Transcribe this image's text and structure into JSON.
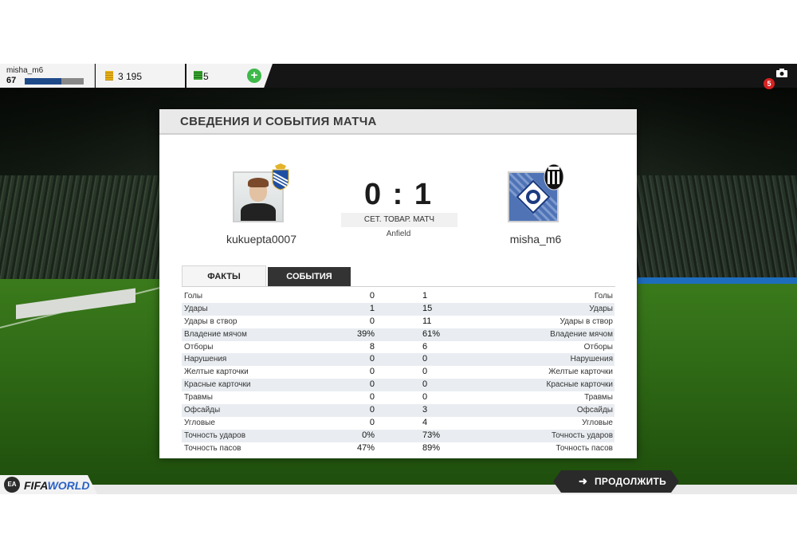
{
  "topbar": {
    "username": "misha_m6",
    "level": "67",
    "xp_fraction": 0.62,
    "coins": "3 195",
    "points": "5",
    "add_label": "+",
    "notification_count": "5"
  },
  "panel": {
    "title": "СВЕДЕНИЯ И СОБЫТИЯ МАТЧА",
    "home_player": "kukuepta0007",
    "away_player": "misha_m6",
    "score": "0 : 1",
    "match_type": "СЕТ. ТОВАР. МАТЧ",
    "venue": "Anfield",
    "tabs": [
      "ФАКТЫ",
      "СОБЫТИЯ"
    ],
    "stats": [
      {
        "label": "Голы",
        "home": "0",
        "away": "1"
      },
      {
        "label": "Удары",
        "home": "1",
        "away": "15"
      },
      {
        "label": "Удары в створ",
        "home": "0",
        "away": "11"
      },
      {
        "label": "Владение мячом",
        "home": "39%",
        "away": "61%"
      },
      {
        "label": "Отборы",
        "home": "8",
        "away": "6"
      },
      {
        "label": "Нарушения",
        "home": "0",
        "away": "0"
      },
      {
        "label": "Желтые карточки",
        "home": "0",
        "away": "0"
      },
      {
        "label": "Красные карточки",
        "home": "0",
        "away": "0"
      },
      {
        "label": "Травмы",
        "home": "0",
        "away": "0"
      },
      {
        "label": "Офсайды",
        "home": "0",
        "away": "3"
      },
      {
        "label": "Угловые",
        "home": "0",
        "away": "4"
      },
      {
        "label": "Точность ударов",
        "home": "0%",
        "away": "73%"
      },
      {
        "label": "Точность пасов",
        "home": "47%",
        "away": "89%"
      }
    ]
  },
  "bottom": {
    "logo_ea": "EA",
    "logo_fifa": "FIFA",
    "logo_world": "WORLD",
    "continue_label": "ПРОДОЛЖИТЬ",
    "continue_arrow": "➜"
  },
  "icons": {
    "camera": "camera-icon",
    "coins": "coins-icon",
    "points": "points-icon"
  },
  "colors": {
    "accent_green": "#3fb94a",
    "badge_red": "#d62222",
    "xp_blue": "#1f4a8a",
    "world_blue": "#2a62c7"
  }
}
